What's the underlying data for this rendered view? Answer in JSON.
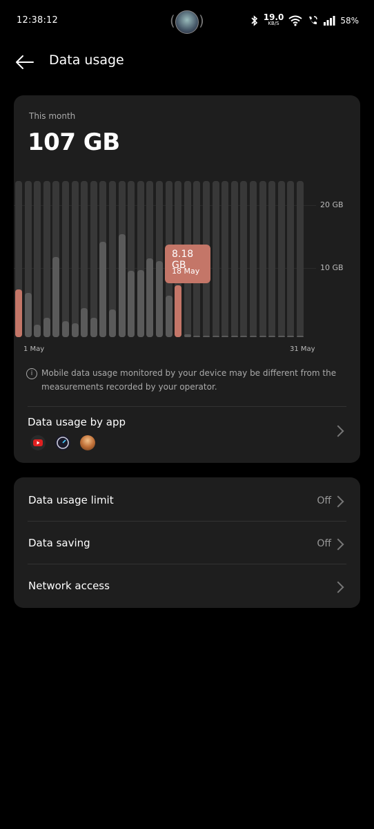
{
  "status_bar": {
    "time": "12:38:12",
    "net_speed": "19.0",
    "net_speed_unit": "KB/S",
    "battery": "58%"
  },
  "header": {
    "title": "Data usage"
  },
  "summary": {
    "period_label": "This month",
    "total": "107 GB"
  },
  "chart_data": {
    "type": "bar",
    "x_start_label": "1 May",
    "x_end_label": "31 May",
    "y_ticks": [
      "20 GB",
      "10 GB"
    ],
    "ylim": [
      0,
      24.6
    ],
    "selected": {
      "value": "8.18 GB",
      "date": "18 May"
    },
    "values": [
      7.5,
      7.0,
      2.0,
      3.0,
      12.6,
      2.5,
      2.2,
      4.6,
      3.0,
      15.0,
      4.4,
      16.2,
      10.4,
      10.6,
      12.4,
      12.0,
      6.5,
      8.18,
      0.4,
      0.2,
      0.1,
      0.1,
      0.1,
      0.1,
      0.1,
      0.1,
      0.1,
      0.1,
      0.1,
      0.1,
      0.1
    ],
    "highlight_color": "#c47668",
    "bar_color": "#5a5a5a",
    "bar_bg_color": "#383838"
  },
  "info": {
    "text": "Mobile data usage monitored by your device may be different from the measurements recorded by your operator."
  },
  "apps_section": {
    "title": "Data usage by app",
    "icons": [
      "youtube-icon",
      "speedometer-icon",
      "profile-photo-icon"
    ]
  },
  "settings": {
    "limit_label": "Data usage limit",
    "limit_value": "Off",
    "saving_label": "Data saving",
    "saving_value": "Off",
    "network_label": "Network access"
  }
}
